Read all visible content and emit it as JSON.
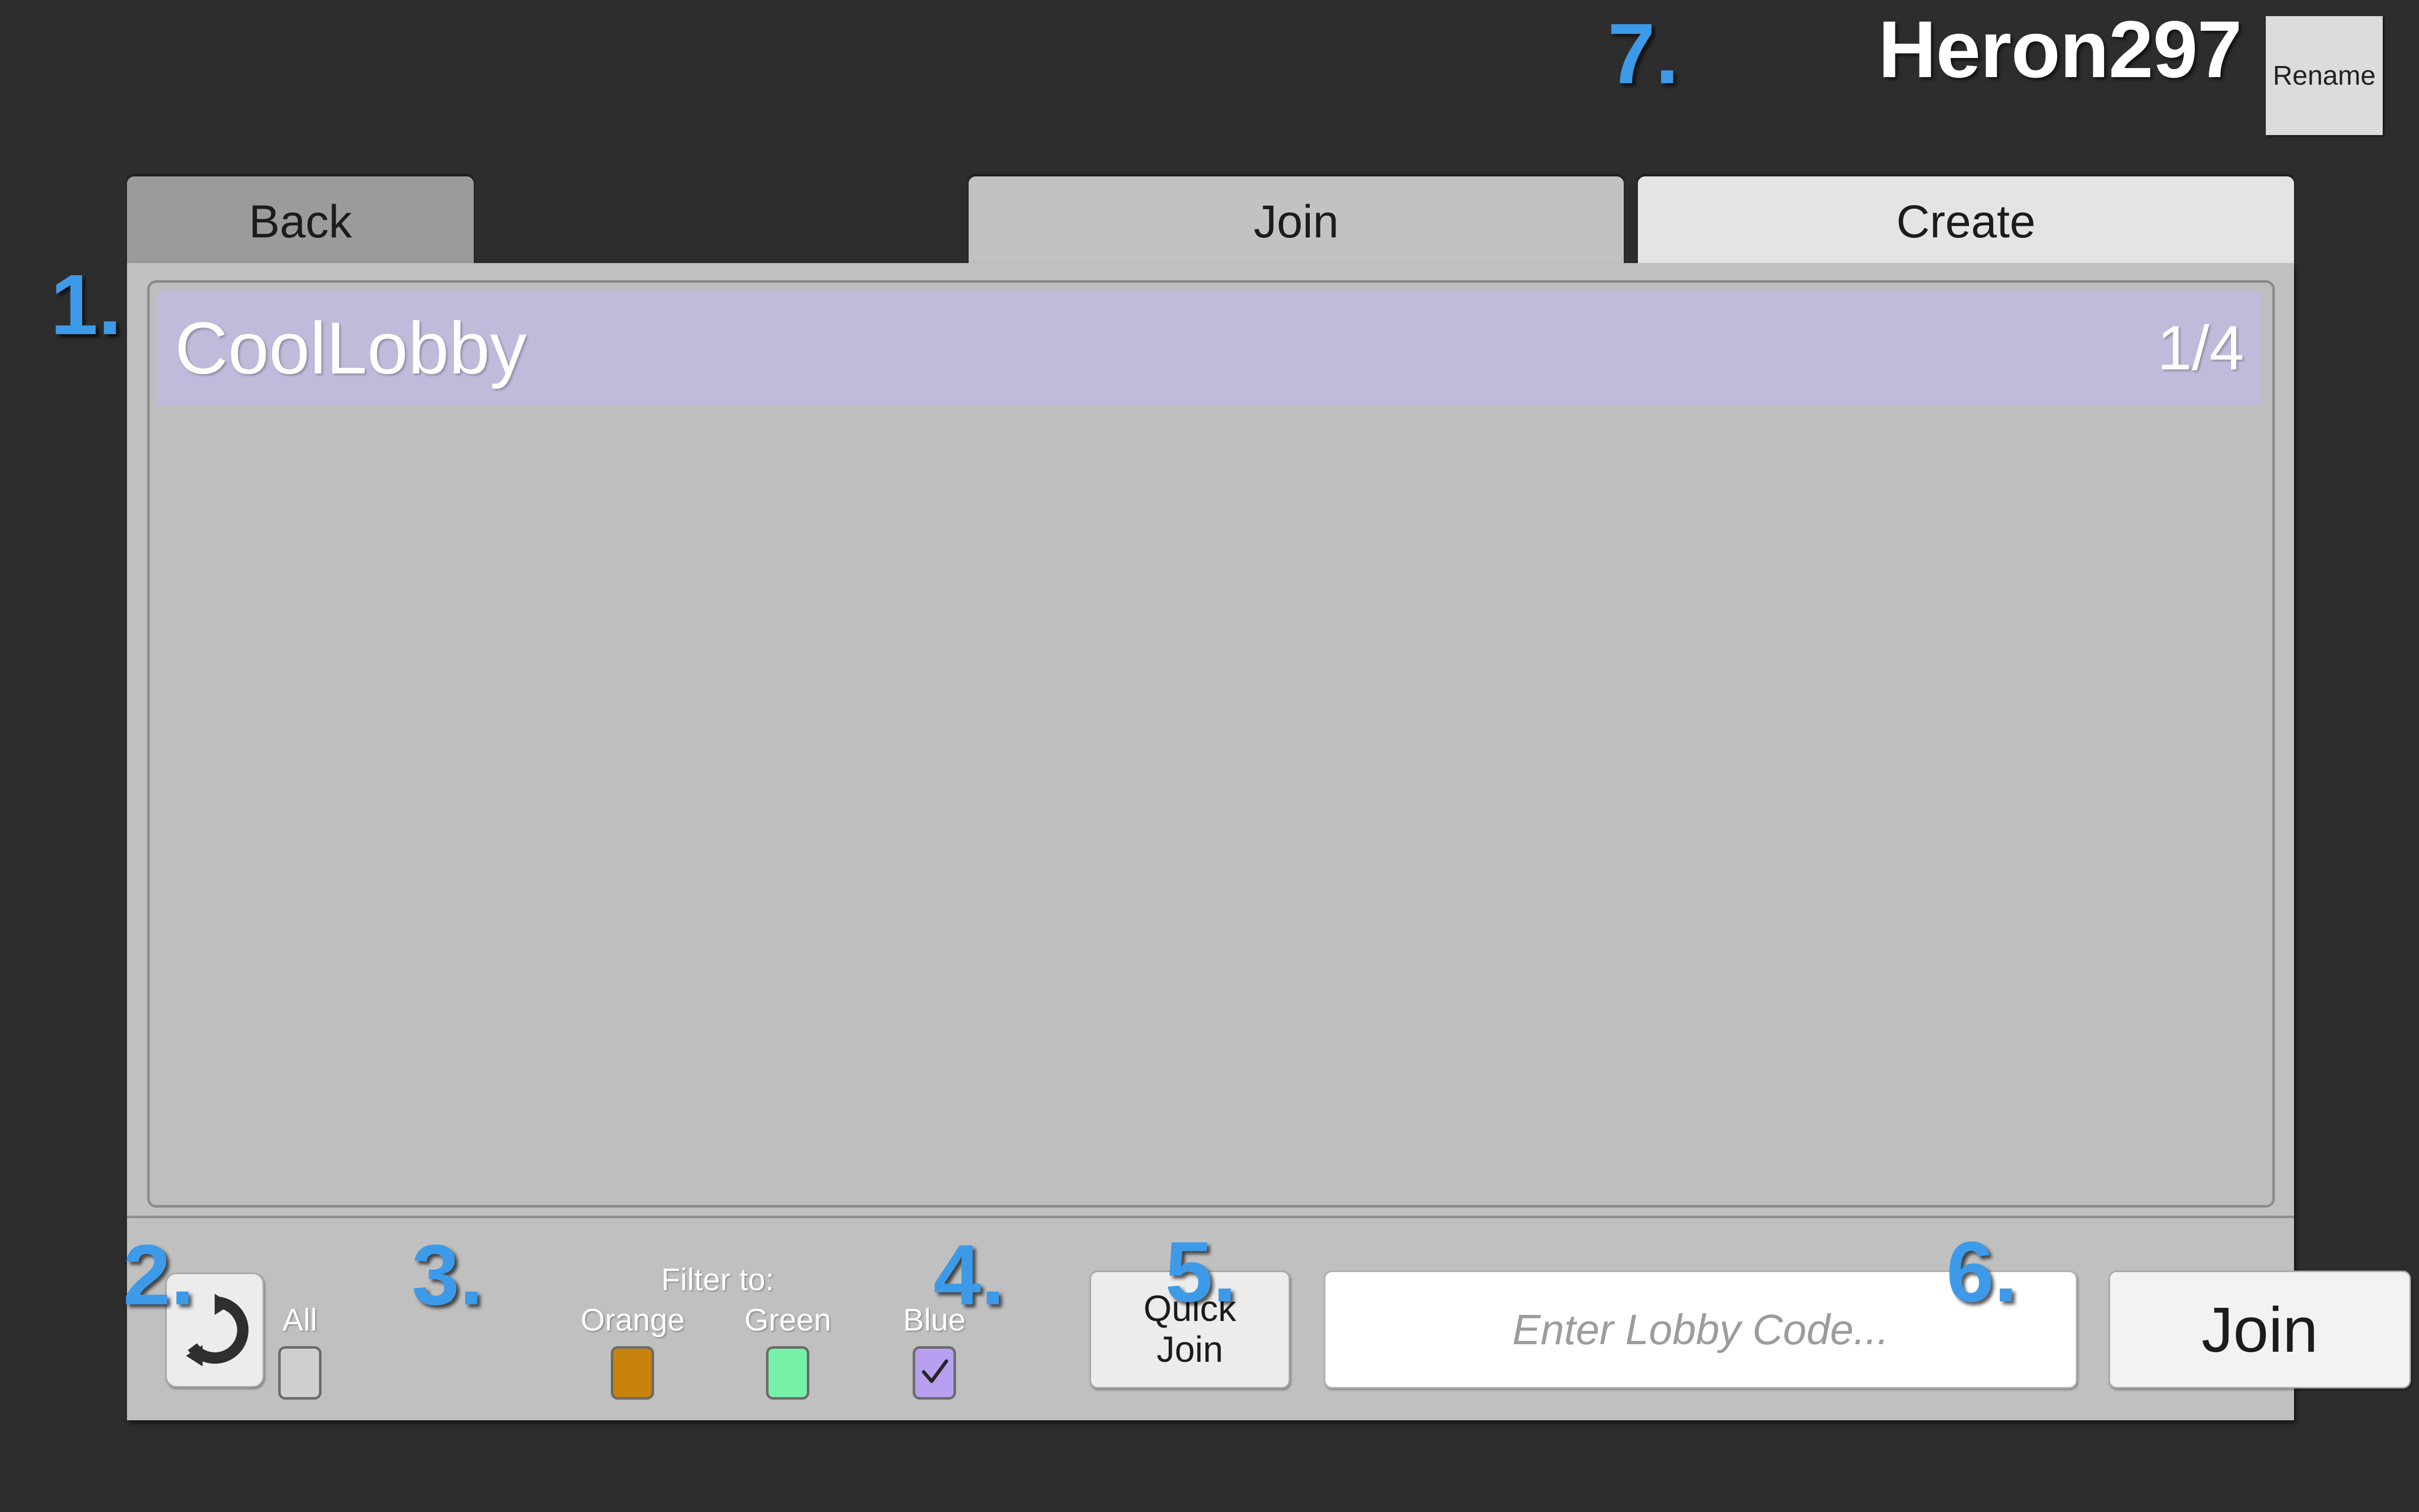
{
  "header": {
    "username": "Heron297",
    "rename_label": "Rename",
    "annotation": "7."
  },
  "tabs": [
    {
      "label": "Back",
      "state": "inactive",
      "annotation": ""
    },
    {
      "label": "Join",
      "state": "active",
      "annotation": ""
    },
    {
      "label": "Create",
      "state": "inactive",
      "annotation": ""
    }
  ],
  "lobby_list": {
    "annotation": "1.",
    "rows": [
      {
        "name": "CoolLobby",
        "players": "1/4",
        "selected": true
      }
    ]
  },
  "toolbar": {
    "refresh": {
      "icon": "refresh-icon",
      "annotation": "2."
    },
    "filter_to_label": "Filter to:",
    "filters_annotation": "3.",
    "filters": [
      {
        "label": "All",
        "checked": false,
        "color": "#cfcfcf"
      },
      {
        "label": "Orange",
        "checked": false,
        "color": "#c8820e"
      },
      {
        "label": "Green",
        "checked": false,
        "color": "#77f0a8"
      },
      {
        "label": "Blue",
        "checked": true,
        "color": "#b8a0f0"
      }
    ],
    "quick_join": {
      "line1": "Quick",
      "line2": "Join",
      "annotation": "4."
    },
    "lobby_code": {
      "placeholder": "Enter Lobby Code...",
      "value": "",
      "annotation": "5."
    },
    "join": {
      "label": "Join",
      "annotation": "6."
    }
  },
  "colors": {
    "background": "#2d2d2d",
    "panel": "#c0c0c0",
    "selected_row": "#c0bbda",
    "annotation_blue": "#3d9ae9"
  }
}
